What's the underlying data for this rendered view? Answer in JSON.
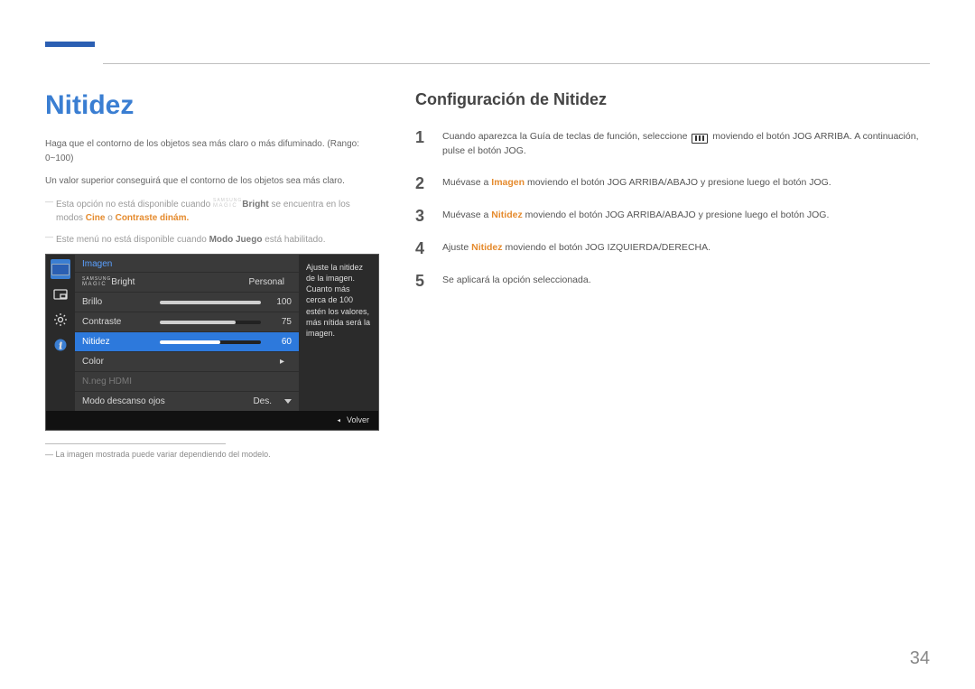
{
  "page_number": "34",
  "left": {
    "title": "Nitidez",
    "intro": "Haga que el contorno de los objetos sea más claro o más difuminado. (Rango: 0~100)",
    "line2": "Un valor superior conseguirá que el contorno de los objetos sea más claro.",
    "note1_pre": "Esta opción no está disponible cuando ",
    "note1_brand_sup": "SAMSUNG",
    "note1_brand_low": "MAGIC",
    "note1_mid": "Bright",
    "note1_post": " se encuentra en los modos ",
    "note1_modes_a": "Cine",
    "note1_sep": " o ",
    "note1_modes_b": "Contraste dinám.",
    "note2_pre": "Este menú no está disponible cuando ",
    "note2_bold": "Modo Juego",
    "note2_post": " está habilitado.",
    "footnote": "La imagen mostrada puede variar dependiendo del modelo."
  },
  "osd": {
    "header": "Imagen",
    "desc": "Ajuste la nitidez de la imagen. Cuanto más cerca de 100 estén los valores, más nítida será la imagen.",
    "magic_sup": "SAMSUNG",
    "magic_low": "MAGIC",
    "magic_suffix": "Bright",
    "magic_value": "Personal",
    "brillo_label": "Brillo",
    "brillo_value": "100",
    "contraste_label": "Contraste",
    "contraste_value": "75",
    "nitidez_label": "Nitidez",
    "nitidez_value": "60",
    "color_label": "Color",
    "hdmi_label": "N.neg HDMI",
    "descanso_label": "Modo descanso ojos",
    "descanso_value": "Des.",
    "footer": "Volver"
  },
  "right": {
    "subtitle": "Configuración de Nitidez",
    "step1_pre": "Cuando aparezca la Guía de teclas de función, seleccione ",
    "step1_post": " moviendo el botón JOG ARRIBA. A continuación, pulse el botón JOG.",
    "step2_pre": "Muévase a ",
    "step2_bold": "Imagen",
    "step2_post": " moviendo el botón JOG ARRIBA/ABAJO y presione luego el botón JOG.",
    "step3_pre": "Muévase a ",
    "step3_bold": "Nitidez",
    "step3_post": " moviendo el botón JOG ARRIBA/ABAJO y presione luego el botón JOG.",
    "step4_pre": "Ajuste ",
    "step4_bold": "Nitidez",
    "step4_post": " moviendo el botón JOG IZQUIERDA/DERECHA.",
    "step5": "Se aplicará la opción seleccionada."
  },
  "nums": {
    "n1": "1",
    "n2": "2",
    "n3": "3",
    "n4": "4",
    "n5": "5"
  }
}
